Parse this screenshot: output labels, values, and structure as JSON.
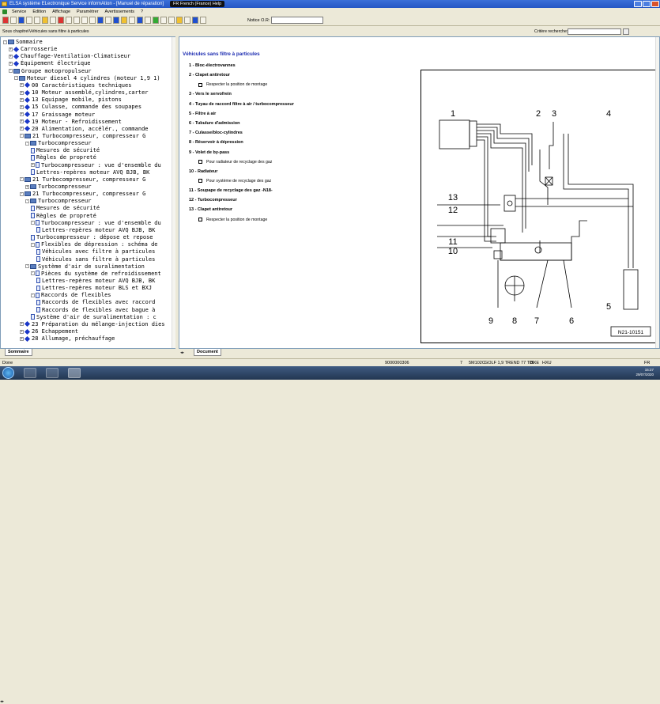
{
  "window": {
    "title": "ELSA système ELectronique Service informAtion - [Manuel de réparation]",
    "lang_tab": "FR French (France)",
    "help": "Help"
  },
  "menu": [
    "Service",
    "Edition",
    "Affichage",
    "Paramètrer",
    "Avertissements",
    "?"
  ],
  "notice": {
    "label": "Notice O.R:",
    "value": ""
  },
  "address": "Sous chapitre\\Véhicules sans filtre à particules",
  "search": {
    "label": "Critère recherche:",
    "value": ""
  },
  "tree": [
    {
      "level": 0,
      "exp": "-",
      "icon": "bk",
      "label": "Sommaire"
    },
    {
      "level": 1,
      "exp": "+",
      "icon": "dia",
      "label": "Carrosserie"
    },
    {
      "level": 1,
      "exp": "+",
      "icon": "dia",
      "label": "Chauffage-Ventilation-Climatiseur"
    },
    {
      "level": 1,
      "exp": "+",
      "icon": "dia",
      "label": "Équipement électrique"
    },
    {
      "level": 1,
      "exp": "-",
      "icon": "bk",
      "label": "Groupe motopropulseur"
    },
    {
      "level": 2,
      "exp": "-",
      "icon": "bk",
      "label": "Moteur diesel 4 cylindres (moteur 1,9 1)"
    },
    {
      "level": 3,
      "exp": "+",
      "icon": "dia",
      "label": "00 Caractéristiques techniques"
    },
    {
      "level": 3,
      "exp": "+",
      "icon": "dia",
      "label": "10 Moteur assemblé,cylindres,carter"
    },
    {
      "level": 3,
      "exp": "+",
      "icon": "dia",
      "label": "13 Equipage mobile, pistons"
    },
    {
      "level": 3,
      "exp": "+",
      "icon": "dia",
      "label": "15 Culasse, commande des soupapes"
    },
    {
      "level": 3,
      "exp": "+",
      "icon": "dia",
      "label": "17 Graissage moteur"
    },
    {
      "level": 3,
      "exp": "+",
      "icon": "dia",
      "label": "19 Moteur - Refroidissement"
    },
    {
      "level": 3,
      "exp": "+",
      "icon": "dia",
      "label": "20 Alimentation, accélér., commande"
    },
    {
      "level": 3,
      "exp": "-",
      "icon": "bk",
      "label": "21 Turbocompresseur, compresseur G"
    },
    {
      "level": 4,
      "exp": "-",
      "icon": "bk",
      "label": "Turbocompresseur"
    },
    {
      "level": 5,
      "exp": "",
      "icon": "doc",
      "label": "Mesures de sécurité"
    },
    {
      "level": 5,
      "exp": "",
      "icon": "doc",
      "label": "Règles de propreté"
    },
    {
      "level": 5,
      "exp": "+",
      "icon": "doc",
      "label": "Turbocompresseur : vue d'ensemble du"
    },
    {
      "level": 5,
      "exp": "",
      "icon": "doc",
      "label": "Lettres-repères moteur AVQ BJB, BK"
    },
    {
      "level": 3,
      "exp": "-",
      "icon": "bk",
      "label": "21 Turbocompresseur, compresseur G"
    },
    {
      "level": 4,
      "exp": "+",
      "icon": "bk",
      "label": "Turbocompresseur"
    },
    {
      "level": 3,
      "exp": "-",
      "icon": "bk",
      "label": "21 Turbocompresseur, compresseur G"
    },
    {
      "level": 4,
      "exp": "-",
      "icon": "bk",
      "label": "Turbocompresseur"
    },
    {
      "level": 5,
      "exp": "",
      "icon": "doc",
      "label": "Mesures de sécurité"
    },
    {
      "level": 5,
      "exp": "",
      "icon": "doc",
      "label": "Règles de propreté"
    },
    {
      "level": 5,
      "exp": "-",
      "icon": "doc",
      "label": "Turbocompresseur : vue d'ensemble du"
    },
    {
      "level": 6,
      "exp": "",
      "icon": "doc",
      "label": "Lettres-repères moteur AVQ BJB, BK"
    },
    {
      "level": 5,
      "exp": "",
      "icon": "doc",
      "label": "Turbocompresseur : dépose et repose"
    },
    {
      "level": 5,
      "exp": "-",
      "icon": "doc",
      "label": "Flexibles de dépression : schéma de"
    },
    {
      "level": 6,
      "exp": "",
      "icon": "doc",
      "label": "Véhicules avec filtre à particules"
    },
    {
      "level": 6,
      "exp": "",
      "icon": "doc",
      "label": "Véhicules sans filtre à particules"
    },
    {
      "level": 4,
      "exp": "-",
      "icon": "bk",
      "label": "Système d'air de suralimentation"
    },
    {
      "level": 5,
      "exp": "-",
      "icon": "doc",
      "label": "Pièces du système de refroidissement"
    },
    {
      "level": 6,
      "exp": "",
      "icon": "doc",
      "label": "Lettres-repères moteur AVQ BJB, BK"
    },
    {
      "level": 6,
      "exp": "",
      "icon": "doc",
      "label": "Lettres-repères moteur BLS et BXJ"
    },
    {
      "level": 5,
      "exp": "-",
      "icon": "doc",
      "label": "Raccords de flexibles"
    },
    {
      "level": 6,
      "exp": "",
      "icon": "doc",
      "label": "Raccords de flexibles avec raccord"
    },
    {
      "level": 6,
      "exp": "",
      "icon": "doc",
      "label": "Raccords de flexibles avec bague à"
    },
    {
      "level": 5,
      "exp": "",
      "icon": "doc",
      "label": "Système d'air de suralimentation : c"
    },
    {
      "level": 3,
      "exp": "+",
      "icon": "dia",
      "label": "23 Préparation du mélange-injection dies"
    },
    {
      "level": 3,
      "exp": "+",
      "icon": "dia",
      "label": "26 Echappement"
    },
    {
      "level": 3,
      "exp": "+",
      "icon": "dia",
      "label": "28 Allumage, préchauffage"
    }
  ],
  "tabs": {
    "left": "Sommaire",
    "right": "Document"
  },
  "document": {
    "title": "Véhicules sans filtre à particules",
    "items": [
      {
        "t": "item",
        "text": "1 - Bloc-électrovannes"
      },
      {
        "t": "item",
        "text": "2 - Clapet antiretour"
      },
      {
        "t": "sub",
        "text": "Respecter la position de montage"
      },
      {
        "t": "item",
        "text": "3 - Vers le servofrein"
      },
      {
        "t": "item",
        "text": "4 - Tuyau de raccord filtre à air / turbocompresseur"
      },
      {
        "t": "item",
        "text": "5 - Filtre à air"
      },
      {
        "t": "item",
        "text": "6 - Tubulure d'admission"
      },
      {
        "t": "item",
        "text": "7 - Culasse/bloc-cylindres"
      },
      {
        "t": "item",
        "text": "8 - Réservoir à dépression"
      },
      {
        "t": "item",
        "text": "9 - Volet de by-pass"
      },
      {
        "t": "sub",
        "text": "Pour radiateur de recyclage des gaz"
      },
      {
        "t": "item",
        "text": "10 - Radiateur"
      },
      {
        "t": "sub",
        "text": "Pour système de recyclage des gaz"
      },
      {
        "t": "item",
        "text": "11 - Soupape de recyclage des gaz -N18-"
      },
      {
        "t": "item",
        "text": "12 - Turbocompresseur"
      },
      {
        "t": "item",
        "text": "13 - Clapet antiretour"
      },
      {
        "t": "sub",
        "text": "Respecter la position de montage"
      }
    ],
    "diagram": {
      "ref": "N21-10151",
      "labels": [
        "1",
        "2",
        "3",
        "4",
        "5",
        "6",
        "7",
        "8",
        "9",
        "10",
        "11",
        "12",
        "13"
      ]
    }
  },
  "status": {
    "left": "Done",
    "code": "9000000306",
    "n": "7",
    "vin": "5M102C",
    "model": "GOLF 1,9 TREND 77 TDI",
    "eng": "BXE",
    "gear": "HXU",
    "lang": "FR"
  },
  "clock": {
    "time": "15:27",
    "date": "29/07/2020"
  }
}
